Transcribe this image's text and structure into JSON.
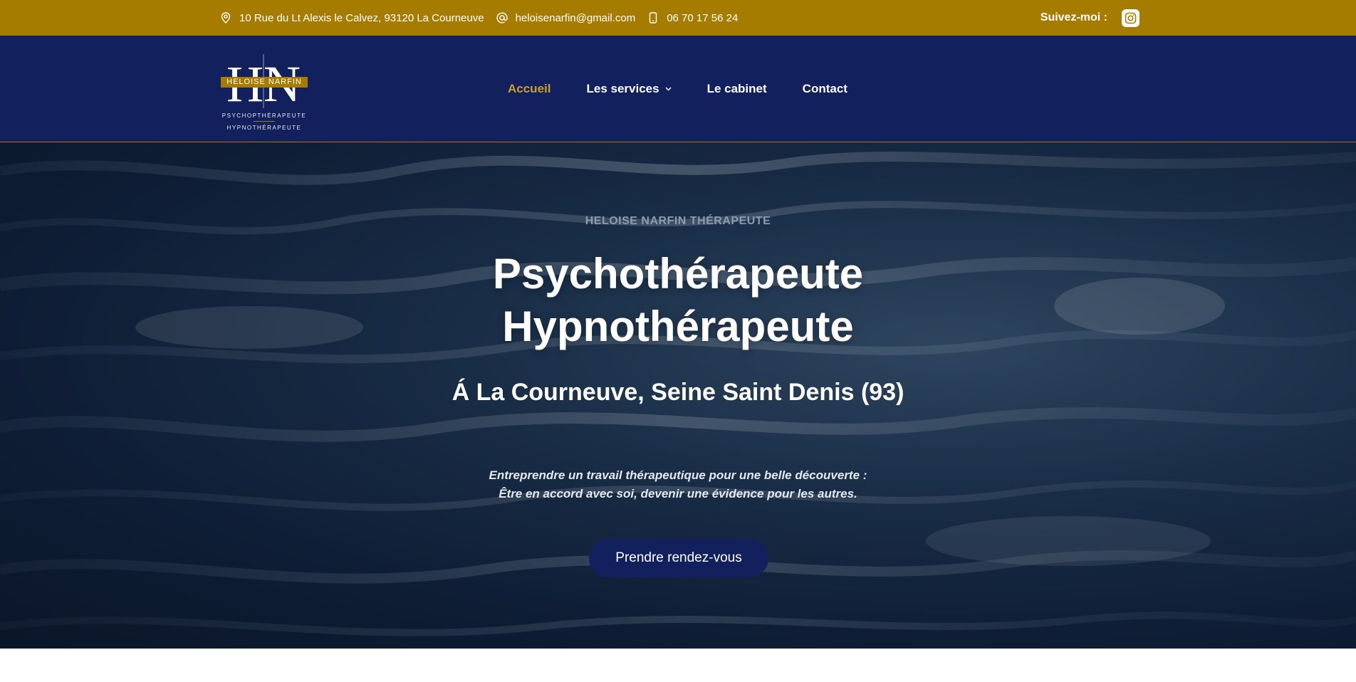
{
  "topbar": {
    "address": "10 Rue du Lt Alexis le Calvez, 93120 La Courneuve",
    "email": "heloisenarfin@gmail.com",
    "phone": "06 70 17 56 24",
    "follow_label": "Suivez-moi :",
    "icons": {
      "address": "map-pin-icon",
      "email": "at-icon",
      "phone": "phone-icon",
      "social": "instagram-icon"
    }
  },
  "logo": {
    "band_text": "HELOISE NARFIN",
    "line1": "PSYCHOPTHÉRAPEUTE",
    "line2": "HYPNOTHÉRAPEUTE"
  },
  "nav": {
    "items": [
      {
        "label": "Accueil",
        "active": true
      },
      {
        "label": "Les services",
        "active": false,
        "has_dropdown": true
      },
      {
        "label": "Le cabinet",
        "active": false
      },
      {
        "label": "Contact",
        "active": false
      }
    ]
  },
  "hero": {
    "eyebrow": "HELOISE NARFIN THÉRAPEUTE",
    "title_line1": "Psychothérapeute",
    "title_line2": "Hypnothérapeute",
    "subtitle": "Á La Courneuve, Seine Saint Denis (93)",
    "quote_line1": "Entreprendre un travail thérapeutique pour une belle découverte :",
    "quote_line2": "Être en accord avec soi, devenir une évidence pour les autres.",
    "cta_label": "Prendre rendez-vous"
  },
  "colors": {
    "gold": "#a67c00",
    "navy": "#12215e",
    "active_link": "#c9a02a"
  }
}
